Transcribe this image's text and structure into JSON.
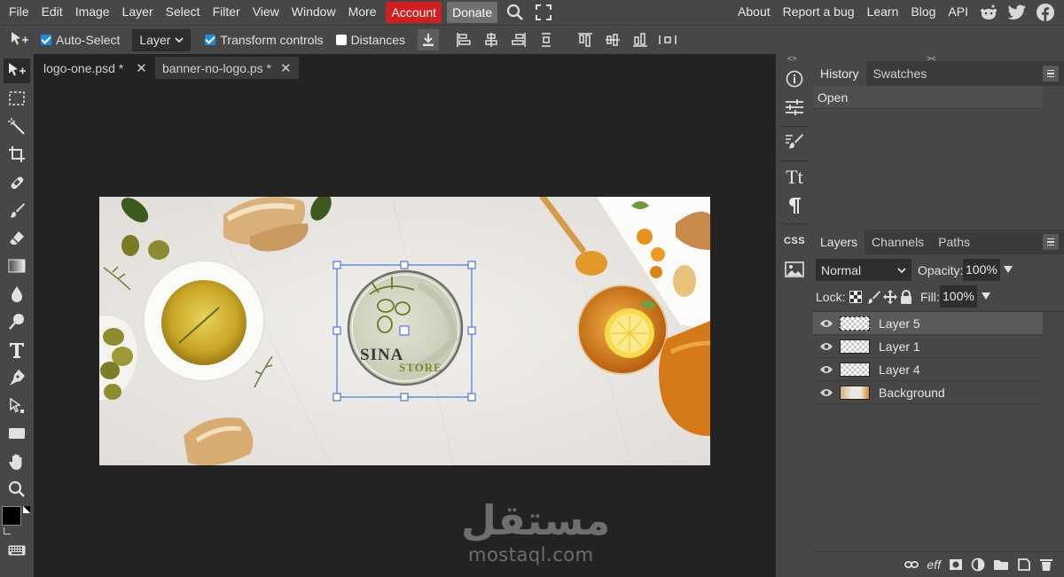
{
  "menu": {
    "items": [
      "File",
      "Edit",
      "Image",
      "Layer",
      "Select",
      "Filter",
      "View",
      "Window",
      "More"
    ],
    "account": "Account",
    "donate": "Donate",
    "right_links": [
      "About",
      "Report a bug",
      "Learn",
      "Blog",
      "API"
    ],
    "icons": [
      "search-icon",
      "fullscreen-icon",
      "reddit-icon",
      "twitter-icon",
      "facebook-icon"
    ]
  },
  "options": {
    "auto_select_label": "Auto-Select",
    "auto_select_checked": true,
    "target_select": "Layer",
    "transform_controls_label": "Transform controls",
    "transform_controls_checked": true,
    "distances_label": "Distances",
    "distances_checked": false
  },
  "tabs": [
    {
      "label": "logo-one.psd *",
      "close": "✕"
    },
    {
      "label": "banner-no-logo.ps *",
      "close": "✕"
    }
  ],
  "logo": {
    "line1": "SINA",
    "line2": "STORE"
  },
  "history_panel": {
    "tabs": [
      "History",
      "Swatches"
    ],
    "items": [
      "Open"
    ]
  },
  "layers_panel": {
    "tabs": [
      "Layers",
      "Channels",
      "Paths"
    ],
    "blend_mode": "Normal",
    "opacity_label": "Opacity:",
    "opacity_value": "100%",
    "lock_label": "Lock:",
    "fill_label": "Fill:",
    "fill_value": "100%",
    "layers": [
      {
        "name": "Layer 5",
        "selected": true
      },
      {
        "name": "Layer 1",
        "selected": false
      },
      {
        "name": "Layer 4",
        "selected": false
      },
      {
        "name": "Background",
        "selected": false
      }
    ],
    "footer_eff": "eff"
  },
  "side_strip": {
    "css_label": "CSS",
    "text_label": "Tt"
  },
  "watermark": {
    "arabic": "مستقل",
    "latin": "mostaql.com"
  },
  "colors": {
    "account": "#d11f1f",
    "accent_check": "#1e8ae8",
    "panel": "#474747",
    "workspace": "#232323"
  }
}
